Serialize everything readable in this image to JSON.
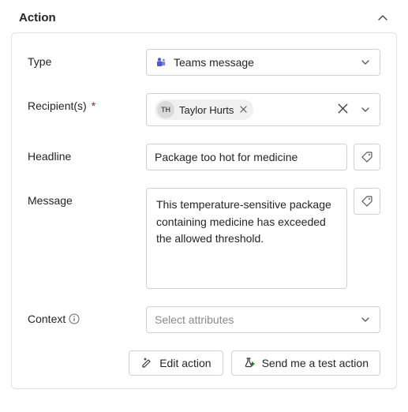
{
  "section": {
    "title": "Action"
  },
  "form": {
    "type": {
      "label": "Type",
      "selected": "Teams message"
    },
    "recipients": {
      "label": "Recipient(s)",
      "required": "*",
      "chip": {
        "initials": "TH",
        "name": "Taylor Hurts"
      }
    },
    "headline": {
      "label": "Headline",
      "value": "Package too hot for medicine"
    },
    "message": {
      "label": "Message",
      "value": "This temperature-sensitive package containing medicine has exceeded the allowed threshold."
    },
    "context": {
      "label": "Context",
      "placeholder": "Select attributes"
    }
  },
  "buttons": {
    "edit": "Edit action",
    "test": "Send me a test action"
  }
}
